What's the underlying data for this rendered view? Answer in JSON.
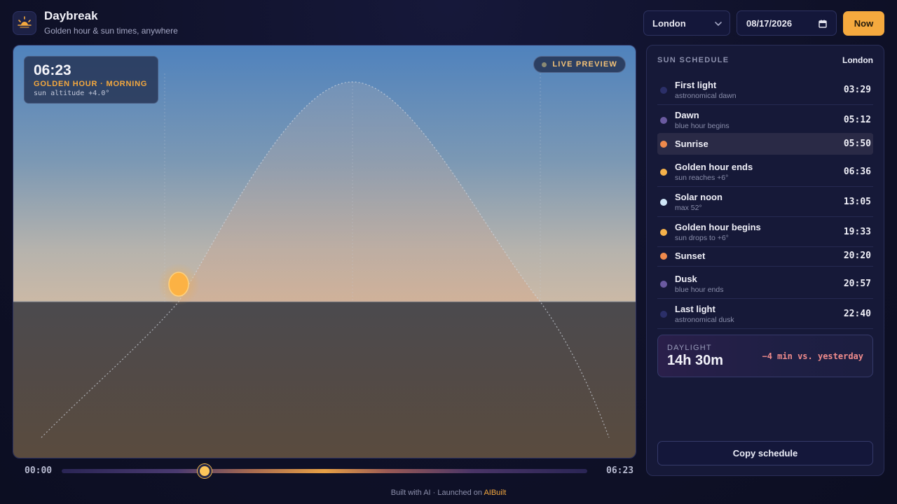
{
  "header": {
    "app_title": "Daybreak",
    "app_subtitle": "Golden hour & sun times, anywhere",
    "city_value": "London",
    "date_value": "08/17/2026",
    "now_label": "Now"
  },
  "preview": {
    "current_time": "06:23",
    "phase_label": "GOLDEN HOUR · MORNING",
    "altitude_text": "sun altitude +4.0°",
    "live_badge": "LIVE PREVIEW"
  },
  "timeline": {
    "start_label": "00:00",
    "current_label": "06:23",
    "position_fraction": 0.272
  },
  "schedule": {
    "title": "SUN SCHEDULE",
    "city": "London",
    "events": [
      {
        "name": "First light",
        "sub": "astronomical dawn",
        "time": "03:29",
        "color": "#2b2f68"
      },
      {
        "name": "Dawn",
        "sub": "blue hour begins",
        "time": "05:12",
        "color": "#6a5aa0"
      },
      {
        "name": "Sunrise",
        "sub": "",
        "time": "05:50",
        "color": "#ef8a4c"
      },
      {
        "name": "Golden hour ends",
        "sub": "sun reaches +6°",
        "time": "06:36",
        "color": "#f5b14a"
      },
      {
        "name": "Solar noon",
        "sub": "max 52°",
        "time": "13:05",
        "color": "#cfe6f7"
      },
      {
        "name": "Golden hour begins",
        "sub": "sun drops to +6°",
        "time": "19:33",
        "color": "#f5b14a"
      },
      {
        "name": "Sunset",
        "sub": "",
        "time": "20:20",
        "color": "#ef8a4c"
      },
      {
        "name": "Dusk",
        "sub": "blue hour ends",
        "time": "20:57",
        "color": "#6a5aa0"
      },
      {
        "name": "Last light",
        "sub": "astronomical dusk",
        "time": "22:40",
        "color": "#2b2f68"
      }
    ],
    "daylight_label": "DAYLIGHT",
    "daylight_value": "14h 30m",
    "daylight_delta": "−4 min vs. yesterday",
    "copy_label": "Copy schedule"
  },
  "footer": {
    "prefix": "Built with AI · Launched on ",
    "brand": "AIBuilt"
  },
  "colors": {
    "accent": "#f5a93e",
    "sun": "#fcb244"
  }
}
